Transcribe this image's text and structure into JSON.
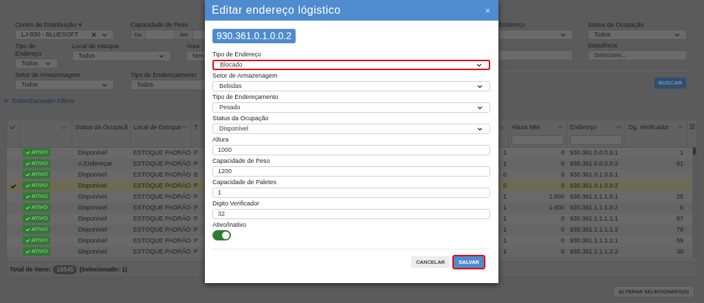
{
  "filters_left": [
    [
      {
        "kind": "select",
        "label": "Centro de Distribuição",
        "required": true,
        "value": "LJ-930 - BLUESOFT",
        "clearable": true
      },
      {
        "kind": "range",
        "label": "Capacidade de Peso",
        "from_label": "De",
        "to_label": "Até"
      }
    ],
    [
      {
        "kind": "select",
        "label": "Tipo de Endereço",
        "value": "Todos"
      },
      {
        "kind": "select",
        "label": "Local de estoque",
        "value": "Todos"
      },
      {
        "kind": "text",
        "label": "Área",
        "placeholder": "Nen"
      }
    ],
    [
      {
        "kind": "select",
        "label": "Setor de Armazenagem",
        "value": "Todos"
      },
      {
        "kind": "select",
        "label": "Tipo de Endereçamento",
        "value": "Todos"
      }
    ]
  ],
  "toggle_filters": "Exibir/Esconder Filtros",
  "filters_right": [
    [
      {
        "kind": "select",
        "label": "Endereço"
      },
      {
        "kind": "select",
        "label": "Status da Ocupação",
        "value": "Todos"
      }
    ],
    [
      {
        "kind": "text"
      },
      {
        "kind": "text",
        "label": "Sequência",
        "placeholder": "Selecione..."
      }
    ]
  ],
  "search_button": "BUSCAR",
  "table": {
    "columns_left": [
      "Status da Ocupaçã",
      "Local de Estoque",
      "T"
    ],
    "columns_right": [
      "Altura MM",
      "Endereço",
      "Dg. Verificador"
    ],
    "rows": [
      {
        "selected": false,
        "badge": "ATIVO",
        "ocupacao": "Disponível",
        "local": "ESTOQUE PADRÃO",
        "col_t": "P",
        "col_r": "1",
        "altura": "0",
        "endereco": "930.361.0.0.0.0.1",
        "dg": "1"
      },
      {
        "selected": false,
        "badge": "ATIVO",
        "ocupacao": "A Endereçar",
        "local": "ESTOQUE PADRÃO",
        "col_t": "P",
        "col_r": "1",
        "altura": "0",
        "endereco": "930.361.0.0.0.0.2",
        "dg": "81"
      },
      {
        "selected": false,
        "badge": "ATIVO",
        "ocupacao": "Disponível",
        "local": "ESTOQUE PADRÃO",
        "col_t": "B",
        "col_r": "0",
        "altura": "0",
        "endereco": "930.361.0.1.0.0.1"
      },
      {
        "selected": true,
        "badge": "ATIVO",
        "ocupacao": "Disponível",
        "local": "ESTOQUE PADRÃO",
        "col_t": "P",
        "col_r": "0",
        "altura": "0",
        "endereco": "930.361.0.1.0.0.2"
      },
      {
        "selected": false,
        "badge": "ATIVO",
        "ocupacao": "Disponível",
        "local": "ESTOQUE PADRÃO",
        "col_t": "P",
        "col_r": "1",
        "altura": "1.600",
        "endereco": "930.361.1.1.1.0.1",
        "dg": "25"
      },
      {
        "selected": false,
        "badge": "ATIVO",
        "ocupacao": "Disponível",
        "local": "ESTOQUE PADRÃO",
        "col_t": "P",
        "col_r": "1",
        "altura": "1.600",
        "endereco": "930.361.1.1.1.0.2",
        "dg": "6"
      },
      {
        "selected": false,
        "badge": "ATIVO",
        "ocupacao": "Disponível",
        "local": "ESTOQUE PADRÃO",
        "col_t": "P",
        "col_r": "1",
        "altura": "0",
        "endereco": "930.361.1.1.1.1.1",
        "dg": "97"
      },
      {
        "selected": false,
        "badge": "ATIVO",
        "ocupacao": "Disponível",
        "local": "ESTOQUE PADRÃO",
        "col_t": "P",
        "col_r": "1",
        "altura": "0",
        "endereco": "930.361.1.1.1.1.2",
        "dg": "78"
      },
      {
        "selected": false,
        "badge": "ATIVO",
        "ocupacao": "Disponível",
        "local": "ESTOQUE PADRÃO",
        "col_t": "P",
        "col_r": "1",
        "altura": "0",
        "endereco": "930.361.1.1.1.2.1",
        "dg": "59"
      },
      {
        "selected": false,
        "badge": "ATIVO",
        "ocupacao": "Disponível",
        "local": "ESTOQUE PADRÃO",
        "col_t": "P",
        "col_r": "1",
        "altura": "0",
        "endereco": "930.361.1.1.1.2.2",
        "dg": "30"
      }
    ]
  },
  "footer": {
    "total_label": "Total de itens:",
    "total": "18545",
    "selected_note": "(Selecionado: 1)"
  },
  "bulk_button": "ALTERAR SELECIONADO(S)",
  "modal": {
    "title": "Editar endereço lógistico",
    "close": "×",
    "badge": "930.361.0.1.0.0.2",
    "fields": [
      {
        "kind": "select",
        "label": "Tipo de Endereço",
        "value": "Blocado",
        "highlighted": true
      },
      {
        "kind": "select",
        "label": "Setor de Armazenagem",
        "value": "Bebidas",
        "highlighted": false
      },
      {
        "kind": "select",
        "label": "Tipo de Endereçamento",
        "value": "Pesado",
        "highlighted": false
      },
      {
        "kind": "select",
        "label": "Status da Ocupação",
        "value": "Disponível",
        "highlighted": false
      },
      {
        "kind": "text",
        "label": "Altura",
        "value": "1000",
        "highlighted": false
      },
      {
        "kind": "text",
        "label": "Capacidade de Peso",
        "value": "1200",
        "highlighted": false
      },
      {
        "kind": "text",
        "label": "Capacidade de Paletes",
        "value": "1",
        "highlighted": false
      },
      {
        "kind": "text",
        "label": "Digito Verificador",
        "value": "32",
        "highlighted": false
      }
    ],
    "toggle": {
      "label": "Ativo/Inativo",
      "on": true
    },
    "buttons": [
      {
        "label": "CANCELAR",
        "kind": "secondary",
        "highlighted": false
      },
      {
        "label": "SALVAR",
        "kind": "primary",
        "highlighted": true
      }
    ]
  }
}
